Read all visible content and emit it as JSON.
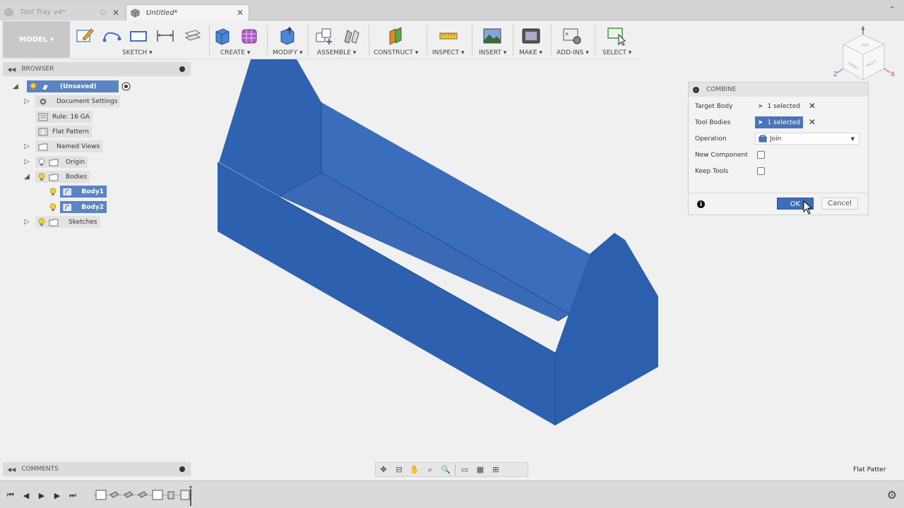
{
  "tabs": [
    {
      "title": "Tool Tray v4*",
      "close": "✕",
      "cloud": "○"
    },
    {
      "title": "Untitled*",
      "close": "✕"
    }
  ],
  "toolbar": {
    "workspace": "MODEL ▾",
    "groups": {
      "sketch": "SKETCH ▾",
      "create": "CREATE ▾",
      "modify": "MODIFY ▾",
      "assemble": "ASSEMBLE ▾",
      "construct": "CONSTRUCT ▾",
      "inspect": "INSPECT ▾",
      "insert": "INSERT ▾",
      "make": "MAKE ▾",
      "addins": "ADD-INS ▾",
      "select": "SELECT ▾"
    }
  },
  "browser": {
    "title": "BROWSER",
    "root": "(Unsaved)",
    "items": {
      "document_settings": "Document Settings",
      "rule": "Rule: 16 GA",
      "flat_pattern": "Flat Pattern",
      "named_views": "Named Views",
      "origin": "Origin",
      "bodies": "Bodies",
      "body1": "Body1",
      "body2": "Body2",
      "sketches": "Sketches"
    }
  },
  "viewcube": {
    "top": "TOP",
    "front": "FRONT",
    "right": "RIGHT",
    "z": "Z",
    "x": "X"
  },
  "dialog": {
    "title": "COMBINE",
    "target_body_label": "Target Body",
    "target_body_value": "1 selected",
    "tool_bodies_label": "Tool Bodies",
    "tool_bodies_value": "1 selected",
    "operation_label": "Operation",
    "operation_value": "Join",
    "new_component_label": "New Component",
    "new_component_checked": false,
    "keep_tools_label": "Keep Tools",
    "keep_tools_checked": false,
    "ok": "OK",
    "cancel": "Cancel",
    "clear": "✕"
  },
  "comments": {
    "title": "COMMENTS"
  },
  "status": {
    "active_feature": "Flat Patter"
  },
  "colors": {
    "body": "#2f63b0",
    "selection": "#5a84c4",
    "ok_button": "#3c6fb6"
  }
}
